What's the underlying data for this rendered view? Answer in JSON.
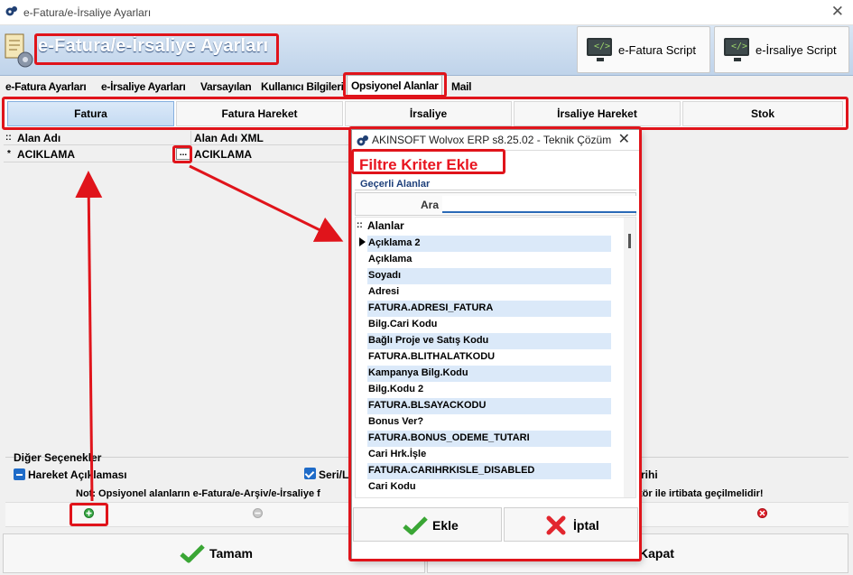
{
  "window": {
    "title": "e-Fatura/e-İrsaliye Ayarları"
  },
  "banner": {
    "title": "e-Fatura/e-İrsaliye Ayarları"
  },
  "toolbar": {
    "efatura_script": "e-Fatura Script",
    "eirsaliye_script": "e-İrsaliye Script"
  },
  "main_tabs": [
    {
      "label": "e-Fatura Ayarları"
    },
    {
      "label": "e-İrsaliye Ayarları"
    },
    {
      "label": "Varsayılan"
    },
    {
      "label": "Kullanıcı Bilgileri"
    },
    {
      "label": "Opsiyonel Alanlar",
      "active": true
    },
    {
      "label": "Mail"
    }
  ],
  "sub_tabs": [
    {
      "label": "Fatura",
      "active": true
    },
    {
      "label": "Fatura Hareket"
    },
    {
      "label": "İrsaliye"
    },
    {
      "label": "İrsaliye Hareket"
    },
    {
      "label": "Stok"
    }
  ],
  "grid": {
    "indicator_header": "::",
    "columns": [
      "Alan Adı",
      "Alan Adı XML"
    ],
    "rows": [
      {
        "marker": "*",
        "alan_adi": "ACIKLAMA",
        "alan_adi_xml": "ACIKLAMA",
        "button": "..."
      }
    ]
  },
  "options": {
    "title": "Diğer Seçenekler",
    "hareket_aciklamasi": "Hareket Açıklaması",
    "seri_partial": "Seri/L",
    "right_partial": "rihi",
    "note_left": "Not: Opsiyonel alanların e-Fatura/e-Arşiv/e-İrsaliye f",
    "note_right": "tör ile irtibata geçilmelidir!"
  },
  "bottom": {
    "ok": "Tamam",
    "close_partial": "Kapat"
  },
  "dialog": {
    "title": "AKINSOFT Wolvox ERP s8.25.02 - Teknik Çözüm",
    "heading": "Filtre Kriter Ekle",
    "section": "Geçerli Alanlar",
    "search_label": "Ara",
    "search_value": "",
    "list_header_icon": "::",
    "list_header": "Alanlar",
    "items": [
      "Açıklama 2",
      "Açıklama",
      "Soyadı",
      "Adresi",
      "FATURA.ADRESI_FATURA",
      "Bilg.Cari Kodu",
      "Bağlı Proje ve Satış Kodu",
      "FATURA.BLITHALATKODU",
      "Kampanya Bilg.Kodu",
      "Bilg.Kodu 2",
      "FATURA.BLSAYACKODU",
      "Bonus Ver?",
      "FATURA.BONUS_ODEME_TUTARI",
      "Cari Hrk.İşle",
      "FATURA.CARIHRKISLE_DISABLED",
      "Cari Kodu"
    ],
    "add_button": "Ekle",
    "cancel_button": "İptal"
  },
  "colors": {
    "highlight_red": "#e0141b",
    "heading_red": "#e8141f",
    "selection_blue": "#dbe9f9",
    "accent_blue": "#1e6bc8"
  }
}
